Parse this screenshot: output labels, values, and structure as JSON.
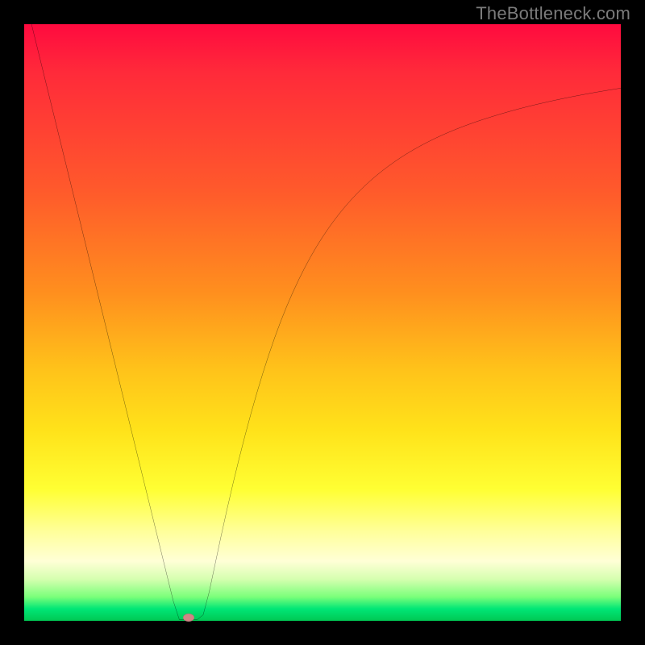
{
  "watermark_text": "TheBottleneck.com",
  "colors": {
    "frame_bg": "#000000",
    "curve_stroke": "#000000",
    "marker_fill": "#d08585",
    "watermark_fg": "#7b7b7b",
    "gradient_stops": [
      "#ff0a3f",
      "#ff2a3a",
      "#ff5a2b",
      "#ff8f1e",
      "#ffc31a",
      "#ffe21a",
      "#ffff33",
      "#ffff9a",
      "#ffffd6",
      "#d6ffb0",
      "#7aff7a",
      "#00e676",
      "#00c853"
    ]
  },
  "chart_data": {
    "type": "line",
    "title": "",
    "xlabel": "",
    "ylabel": "",
    "xlim": [
      0,
      100
    ],
    "ylim": [
      0,
      100
    ],
    "x": [
      0,
      1,
      2,
      3,
      4,
      5,
      6,
      7,
      8,
      9,
      10,
      11,
      12,
      13,
      14,
      15,
      16,
      17,
      18,
      19,
      20,
      21,
      22,
      23,
      24,
      25,
      26,
      27,
      28,
      29,
      30,
      31,
      32,
      33,
      34,
      35,
      36,
      37,
      38,
      39,
      40,
      41,
      42,
      43,
      44,
      45,
      46,
      47,
      48,
      49,
      50,
      51,
      52,
      53,
      54,
      55,
      56,
      57,
      58,
      59,
      60,
      61,
      62,
      63,
      64,
      65,
      66,
      67,
      68,
      69,
      70,
      71,
      72,
      73,
      74,
      75,
      76,
      77,
      78,
      79,
      80,
      81,
      82,
      83,
      84,
      85,
      86,
      87,
      88,
      89,
      90,
      91,
      92,
      93,
      94,
      95,
      96,
      97,
      98,
      99,
      100
    ],
    "series": [
      {
        "name": "bottleneck_curve",
        "values": [
          105,
          100.93,
          96.86,
          92.79,
          88.72,
          84.66,
          80.59,
          76.52,
          72.45,
          68.38,
          64.31,
          60.24,
          56.17,
          52.1,
          48.03,
          43.97,
          39.9,
          35.83,
          31.76,
          27.69,
          23.62,
          19.55,
          15.48,
          11.41,
          7.34,
          3.28,
          0.2,
          0.2,
          0.2,
          0.2,
          1,
          4.8,
          9.5,
          14.2,
          18.7,
          23,
          27.1,
          31,
          34.7,
          38.2,
          41.5,
          44.6,
          47.5,
          50.2,
          52.7,
          55,
          57.15,
          59.15,
          61,
          62.72,
          64.32,
          65.8,
          67.18,
          68.47,
          69.67,
          70.79,
          71.84,
          72.82,
          73.74,
          74.6,
          75.41,
          76.17,
          76.89,
          77.57,
          78.21,
          78.81,
          79.38,
          79.92,
          80.43,
          80.92,
          81.38,
          81.82,
          82.24,
          82.64,
          83.02,
          83.38,
          83.73,
          84.06,
          84.38,
          84.69,
          84.99,
          85.28,
          85.56,
          85.83,
          86.09,
          86.34,
          86.58,
          86.81,
          87.04,
          87.26,
          87.47,
          87.68,
          87.88,
          88.07,
          88.26,
          88.44,
          88.62,
          88.79,
          88.96,
          89.12,
          89.28
        ]
      }
    ],
    "minimum_marker": {
      "x_pct": 27.5,
      "y_pct": 0.6
    },
    "grid": false,
    "legend": false
  }
}
